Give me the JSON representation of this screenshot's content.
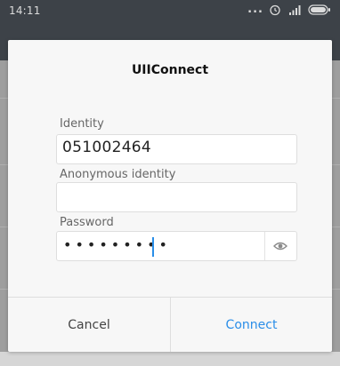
{
  "status_bar": {
    "time": "14:11",
    "more_indicator": "...",
    "icons": [
      "alarm-icon",
      "signal-icon",
      "battery-icon"
    ]
  },
  "dialog": {
    "title": "UIIConnect",
    "fields": {
      "identity": {
        "label": "Identity",
        "value": "051002464"
      },
      "anonymous_identity": {
        "label": "Anonymous identity",
        "value": ""
      },
      "password": {
        "label": "Password",
        "masked_value": "•••••••••",
        "toggle_icon": "eye-icon"
      }
    },
    "buttons": {
      "cancel": "Cancel",
      "connect": "Connect"
    }
  },
  "colors": {
    "accent": "#2a8ee8",
    "scrim": "#9e9e9e",
    "dialog_bg": "#f7f7f7"
  }
}
